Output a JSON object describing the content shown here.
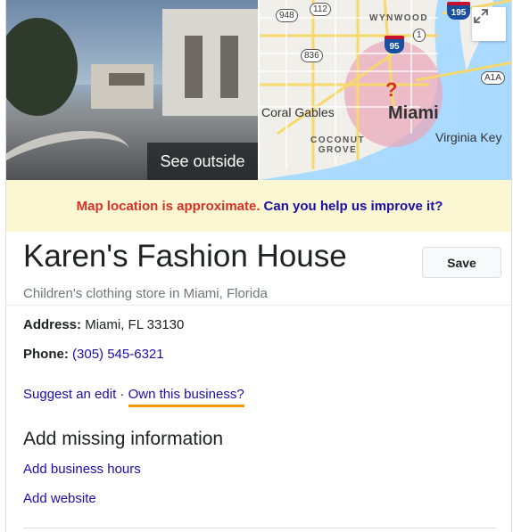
{
  "media": {
    "street_view_label": "See outside",
    "map": {
      "labels": {
        "coral_gables": "Coral Gables",
        "miami": "Miami",
        "virginia_key": "Virginia Key",
        "wynwood": "WYNWOOD",
        "coconut_grove_1": "COCONUT",
        "coconut_grove_2": "GROVE"
      },
      "shields": {
        "r948": "948",
        "r112": "112",
        "r836": "836",
        "a1a": "A1A",
        "us1": "1",
        "i95": "95",
        "i195": "195"
      },
      "marker": "?"
    }
  },
  "notice": {
    "warning": "Map location is approximate.",
    "link": "Can you help us improve it?"
  },
  "business": {
    "name": "Karen's Fashion House",
    "category": "Children's clothing store in Miami, Florida",
    "save_label": "Save",
    "address_label": "Address:",
    "address_value": "Miami, FL 33130",
    "phone_label": "Phone:",
    "phone_value": "(305) 545-6321",
    "suggest_edit": "Suggest an edit",
    "separator": "·",
    "own_business": "Own this business?"
  },
  "missing": {
    "heading": "Add missing information",
    "add_hours": "Add business hours",
    "add_website": "Add website"
  },
  "colors": {
    "link": "#1a0dab",
    "warning": "#d93025",
    "notice_bg": "#fcf7d3",
    "highlight": "#f29900"
  }
}
